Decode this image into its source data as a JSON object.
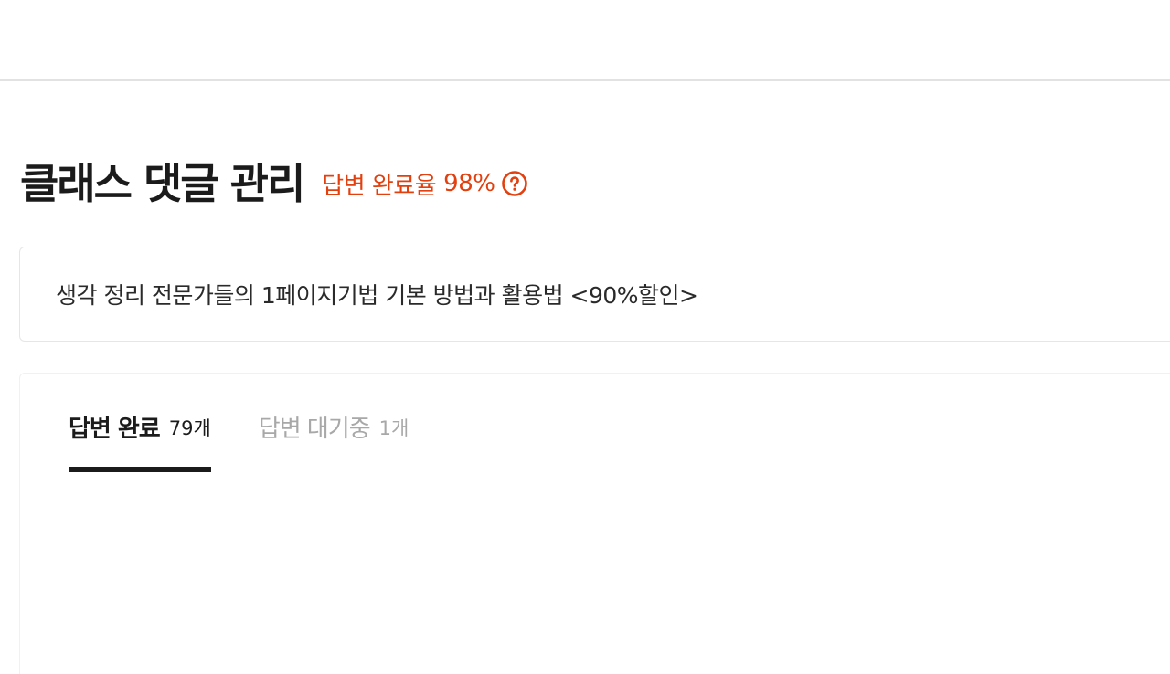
{
  "header": {
    "title": "클래스 댓글 관리",
    "answer_rate_label": "답변 완료율",
    "answer_rate_value": "98%",
    "help_icon": "question-circle-icon"
  },
  "class_card": {
    "class_name": "생각 정리 전문가들의 1페이지기법 기본 방법과 활용법 <90%할인>"
  },
  "tabs": [
    {
      "label": "답변 완료",
      "count": "79개",
      "active": true
    },
    {
      "label": "답변 대기중",
      "count": "1개",
      "active": false
    }
  ],
  "colors": {
    "accent": "#e2400f",
    "title": "#1b1b1b",
    "inactive_tab": "#a8a8a8",
    "divider": "#e2e2e2"
  }
}
